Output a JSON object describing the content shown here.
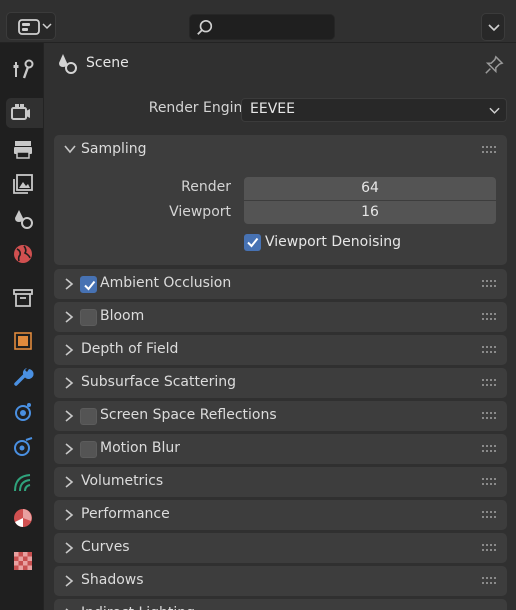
{
  "header": {
    "search_placeholder": ""
  },
  "scene": {
    "title": "Scene"
  },
  "render_engine": {
    "label": "Render Engine",
    "value": "EEVEE"
  },
  "sampling": {
    "title": "Sampling",
    "render_label": "Render",
    "render_value": "64",
    "viewport_label": "Viewport",
    "viewport_value": "16",
    "denoise_label": "Viewport Denoising",
    "denoise_checked": true
  },
  "panels": [
    {
      "title": "Ambient Occlusion",
      "checkbox": true,
      "checked": true
    },
    {
      "title": "Bloom",
      "checkbox": true,
      "checked": false
    },
    {
      "title": "Depth of Field",
      "checkbox": false
    },
    {
      "title": "Subsurface Scattering",
      "checkbox": false
    },
    {
      "title": "Screen Space Reflections",
      "checkbox": true,
      "checked": false
    },
    {
      "title": "Motion Blur",
      "checkbox": true,
      "checked": false
    },
    {
      "title": "Volumetrics",
      "checkbox": false
    },
    {
      "title": "Performance",
      "checkbox": false
    },
    {
      "title": "Curves",
      "checkbox": false
    },
    {
      "title": "Shadows",
      "checkbox": false
    },
    {
      "title": "Indirect Lighting",
      "checkbox": false
    }
  ],
  "tabs": [
    {
      "name": "tool-icon",
      "color": "#c8c8c8"
    },
    {
      "name": "render-properties-icon",
      "color": "#c8c8c8",
      "active": true
    },
    {
      "name": "output-properties-icon",
      "color": "#c8c8c8"
    },
    {
      "name": "view-layer-icon",
      "color": "#c8c8c8"
    },
    {
      "name": "scene-properties-icon",
      "color": "#c8c8c8"
    },
    {
      "name": "world-icon",
      "color": "#d05050"
    },
    {
      "name": "collection-icon",
      "color": "#c8c8c8"
    },
    {
      "name": "object-icon",
      "color": "#e08a3c"
    },
    {
      "name": "modifier-icon",
      "color": "#4a90e2"
    },
    {
      "name": "particles-icon",
      "color": "#4a90e2"
    },
    {
      "name": "physics-icon",
      "color": "#4a90e2"
    },
    {
      "name": "object-constraint-icon",
      "color": "#2fa37c"
    },
    {
      "name": "object-data-icon",
      "color": "#d05050"
    },
    {
      "name": "texture-icon",
      "color": "#d05050"
    }
  ],
  "colors": {
    "accent": "#4772b3",
    "panel": "#3d3d3d",
    "background": "#303030"
  }
}
